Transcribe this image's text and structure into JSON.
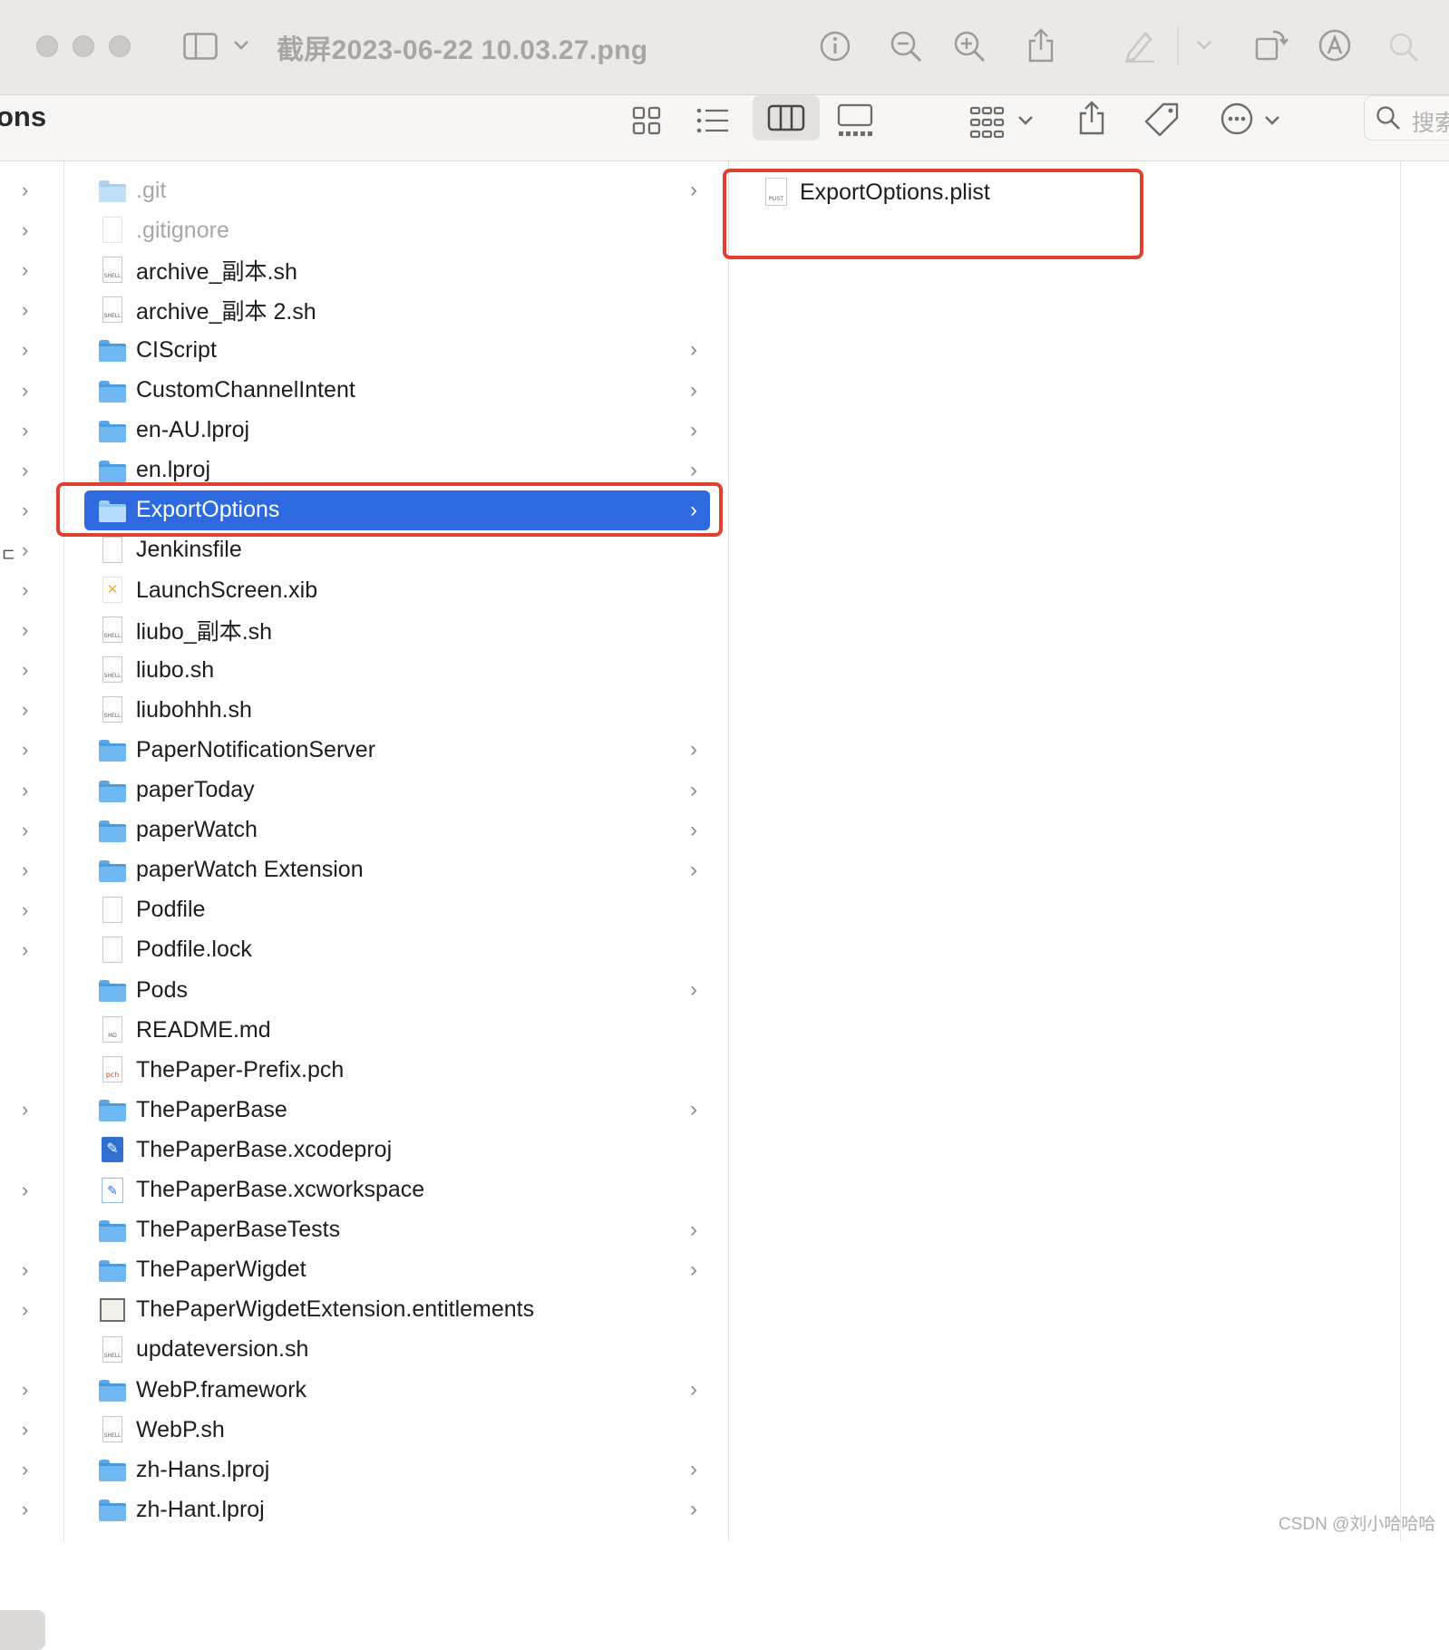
{
  "titlebar": {
    "document_title": "截屏2023-06-22 10.03.27.png",
    "icons": [
      "sidebar-toggle-icon",
      "chevron-down-icon",
      "info-icon",
      "zoom-out-icon",
      "zoom-in-icon",
      "share-icon",
      "markup-pen-icon",
      "chevron-down-icon",
      "rotate-icon",
      "markup-circle-icon",
      "search-icon"
    ]
  },
  "toolbar": {
    "window_title_fragment": "ons",
    "search_placeholder": "搜索"
  },
  "middle_column": {
    "selected_index": 8,
    "items": [
      {
        "name": ".git",
        "kind": "folder",
        "dim": true,
        "chevron": true
      },
      {
        "name": ".gitignore",
        "kind": "file",
        "dim": true,
        "chevron": false
      },
      {
        "name": "archive_副本.sh",
        "kind": "shell",
        "dim": false,
        "chevron": false
      },
      {
        "name": "archive_副本 2.sh",
        "kind": "shell",
        "dim": false,
        "chevron": false
      },
      {
        "name": "CIScript",
        "kind": "folder",
        "dim": false,
        "chevron": true
      },
      {
        "name": "CustomChannelIntent",
        "kind": "folder",
        "dim": false,
        "chevron": true
      },
      {
        "name": "en-AU.lproj",
        "kind": "folder",
        "dim": false,
        "chevron": true
      },
      {
        "name": "en.lproj",
        "kind": "folder",
        "dim": false,
        "chevron": true
      },
      {
        "name": "ExportOptions",
        "kind": "folder",
        "dim": false,
        "chevron": true
      },
      {
        "name": "Jenkinsfile",
        "kind": "file",
        "dim": false,
        "chevron": false
      },
      {
        "name": "LaunchScreen.xib",
        "kind": "xib",
        "dim": false,
        "chevron": false
      },
      {
        "name": "liubo_副本.sh",
        "kind": "shell",
        "dim": false,
        "chevron": false
      },
      {
        "name": "liubo.sh",
        "kind": "shell",
        "dim": false,
        "chevron": false
      },
      {
        "name": "liubohhh.sh",
        "kind": "shell",
        "dim": false,
        "chevron": false
      },
      {
        "name": "PaperNotificationServer",
        "kind": "folder",
        "dim": false,
        "chevron": true
      },
      {
        "name": "paperToday",
        "kind": "folder",
        "dim": false,
        "chevron": true
      },
      {
        "name": "paperWatch",
        "kind": "folder",
        "dim": false,
        "chevron": true
      },
      {
        "name": "paperWatch Extension",
        "kind": "folder",
        "dim": false,
        "chevron": true
      },
      {
        "name": "Podfile",
        "kind": "file",
        "dim": false,
        "chevron": false
      },
      {
        "name": "Podfile.lock",
        "kind": "file",
        "dim": false,
        "chevron": false
      },
      {
        "name": "Pods",
        "kind": "folder",
        "dim": false,
        "chevron": true
      },
      {
        "name": "README.md",
        "kind": "md",
        "dim": false,
        "chevron": false
      },
      {
        "name": "ThePaper-Prefix.pch",
        "kind": "pch",
        "dim": false,
        "chevron": false
      },
      {
        "name": "ThePaperBase",
        "kind": "folder",
        "dim": false,
        "chevron": true
      },
      {
        "name": "ThePaperBase.xcodeproj",
        "kind": "xcodeproj",
        "dim": false,
        "chevron": false
      },
      {
        "name": "ThePaperBase.xcworkspace",
        "kind": "xcworkspace",
        "dim": false,
        "chevron": false
      },
      {
        "name": "ThePaperBaseTests",
        "kind": "folder",
        "dim": false,
        "chevron": true
      },
      {
        "name": "ThePaperWigdet",
        "kind": "folder",
        "dim": false,
        "chevron": true
      },
      {
        "name": "ThePaperWigdetExtension.entitlements",
        "kind": "entitlements",
        "dim": false,
        "chevron": false
      },
      {
        "name": "updateversion.sh",
        "kind": "shell",
        "dim": false,
        "chevron": false
      },
      {
        "name": "WebP.framework",
        "kind": "folder",
        "dim": false,
        "chevron": true
      },
      {
        "name": "WebP.sh",
        "kind": "shell",
        "dim": false,
        "chevron": false
      },
      {
        "name": "zh-Hans.lproj",
        "kind": "folder",
        "dim": false,
        "chevron": true
      },
      {
        "name": "zh-Hant.lproj",
        "kind": "folder",
        "dim": false,
        "chevron": true
      }
    ]
  },
  "right_column": {
    "items": [
      {
        "name": "ExportOptions.plist",
        "kind": "plist"
      }
    ]
  },
  "icon_labels": {
    "shell": "SHELL",
    "md": "MD",
    "pch": "pch",
    "plist": "PLIST"
  },
  "left_column": {
    "fragment_char": "ㄷ"
  },
  "colors": {
    "selection": "#2d6ae0",
    "highlight_box": "#e0412f",
    "folder": "#6fb8f1"
  },
  "watermark": "CSDN @刘小哈哈哈"
}
